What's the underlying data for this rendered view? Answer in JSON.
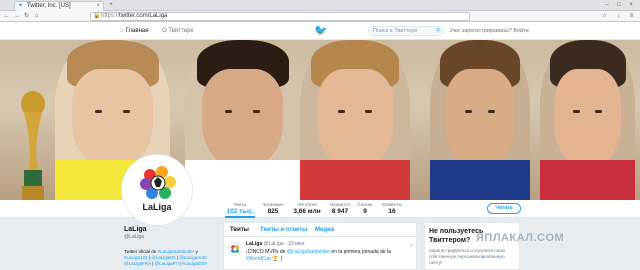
{
  "browser": {
    "tab_title": "Twitter, Inc. [US]",
    "url_scheme": "https://",
    "url_host": "twitter.com/LaLiga"
  },
  "topbar": {
    "home_label": "Главная",
    "about_label": "О Твиттере",
    "search_placeholder": "Поиск в Твиттере",
    "signup_text": "Уже зарегистрированы? Войти"
  },
  "profile": {
    "name": "LaLiga",
    "logo_text": "LaLiga",
    "handle": "@LaLiga",
    "bio_prefix": "Twitter oficial de ",
    "bio_link1": "#LaLigaSantander",
    "bio_mid1": " y ",
    "bio_link2": "#LaLiga123",
    "bio_line2": " | ",
    "bio_link3": "@LaLigaEN",
    "bio_sep": " | ",
    "bio_link4": "@LaLigaArab",
    "bio_line3_link1": "@LaLigaFRA",
    "bio_line3_link2": "@LaLigaPT",
    "bio_line3_link3": "#LaLigaESP"
  },
  "stats": [
    {
      "label": "Твиты",
      "value": "102 тыс."
    },
    {
      "label": "Читаемые",
      "value": "825"
    },
    {
      "label": "Читатели",
      "value": "3,66 млн"
    },
    {
      "label": "Нравится",
      "value": "8 947"
    },
    {
      "label": "Списки",
      "value": "9"
    },
    {
      "label": "Моменты",
      "value": "16"
    }
  ],
  "follow_button": "Читать",
  "timeline": {
    "tabs": [
      "Твиты",
      "Твиты и ответы",
      "Медиа"
    ],
    "tweet": {
      "author": "LaLiga",
      "handle": "@LaLiga",
      "time": "· 13 июн.",
      "text_prefix": "¡CINCO MVPs de ",
      "text_link1": "@LaLigaSantander",
      "text_mid": " en la primera jornada de la ",
      "text_link2": "#WorldCup",
      "text_suffix": " 🏆❗",
      "more": "⌄"
    }
  },
  "side_card": {
    "title": "Не пользуетесь Твиттером?",
    "text": "Зарегистрируйтесь и получите свою собственную персонализированную ленту!"
  },
  "watermark": "ЯПЛАКАЛ.COM",
  "colors": {
    "accent": "#1da1f2",
    "text": "#14171a",
    "muted": "#657786"
  },
  "icons": {
    "home": "home-icon",
    "bird": "twitter-bird-icon",
    "search": "search-icon"
  }
}
